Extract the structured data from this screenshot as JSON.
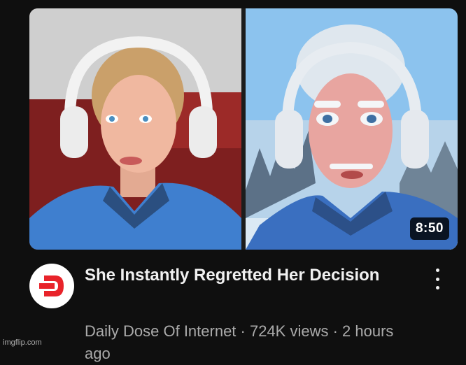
{
  "video": {
    "title": "She Instantly Regretted Her Decision",
    "duration": "8:50",
    "channel": "Daily Dose Of Internet",
    "meta_line": "Daily Dose Of Internet · 724K views · 2 hours ago"
  },
  "icons": {
    "channel_avatar": "daily-dose-logo-icon",
    "more": "more-vert-icon"
  },
  "watermark": "imgflip.com",
  "colors": {
    "background": "#0f0f0f",
    "title": "#f1f1f1",
    "meta": "#aaaaaa",
    "brand_red": "#e8232a"
  }
}
